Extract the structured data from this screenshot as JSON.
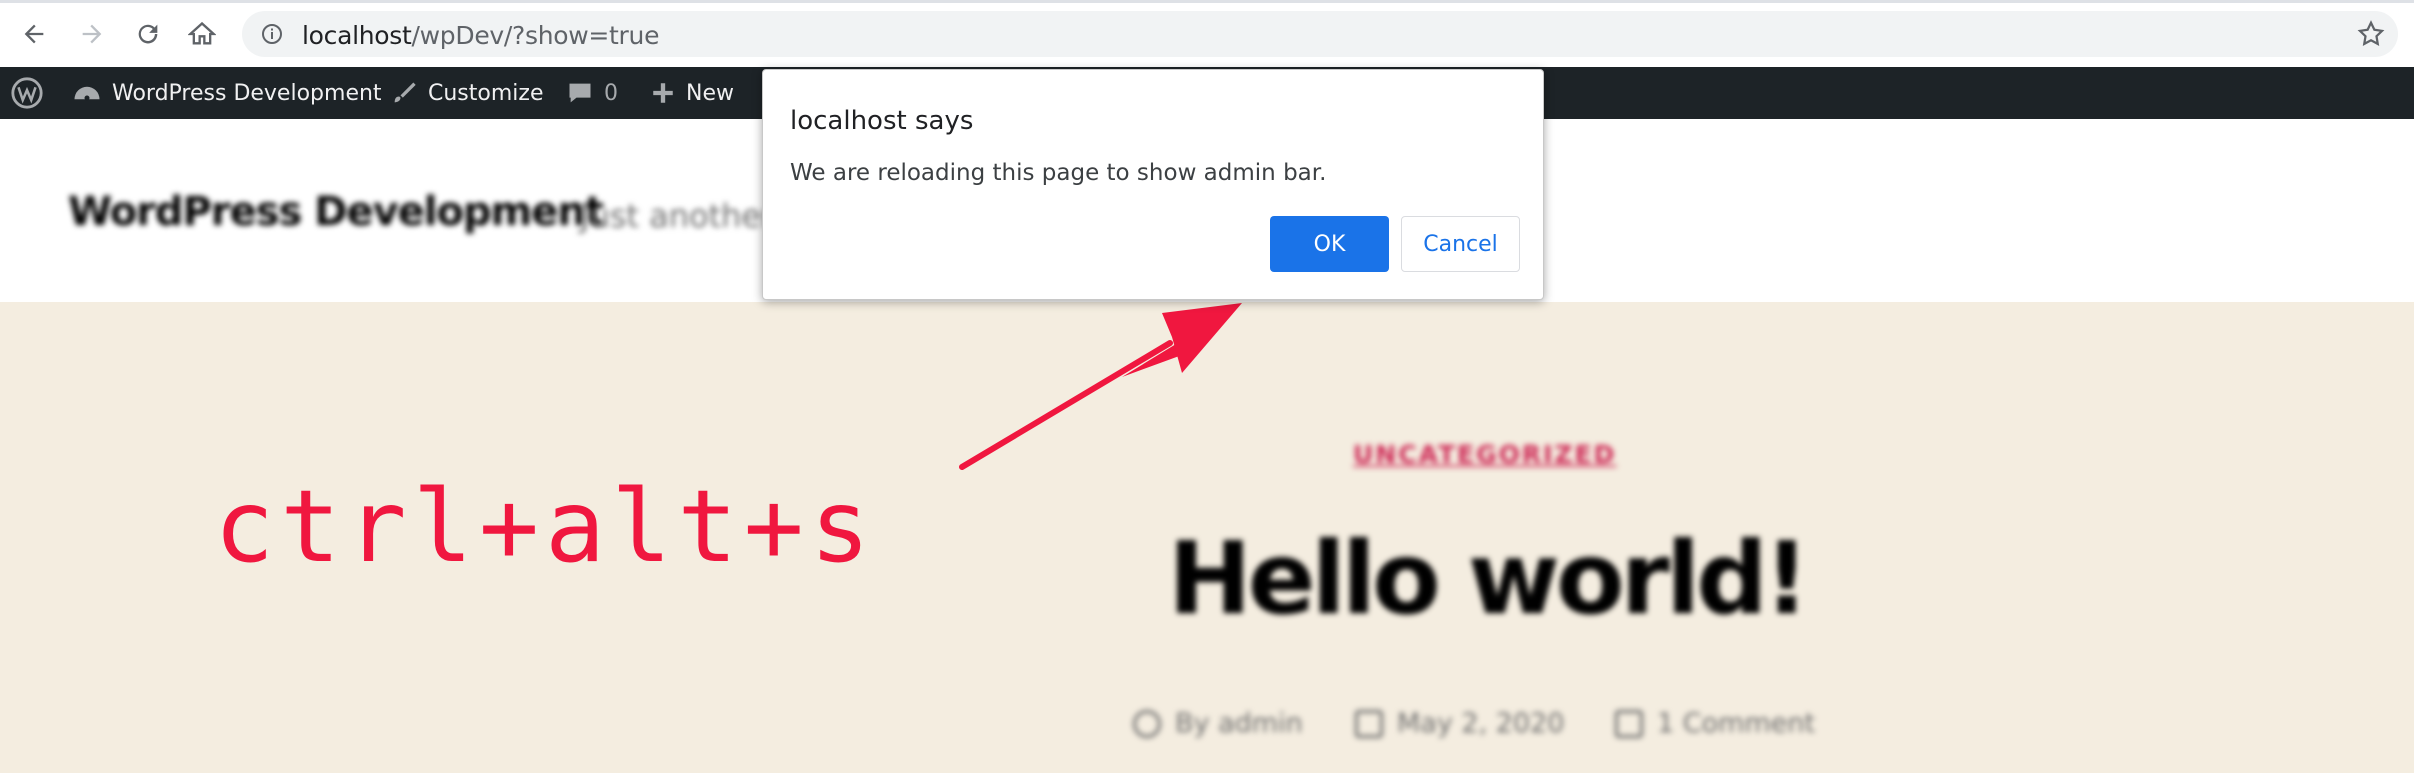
{
  "browser": {
    "url_host": "localhost",
    "url_path": "/wpDev/?show=true",
    "icons": [
      "back-icon",
      "forward-icon",
      "reload-icon",
      "home-icon",
      "info-icon",
      "bookmark-star-icon"
    ]
  },
  "adminbar": {
    "site_name": "WordPress Development",
    "customize": "Customize",
    "comments_count": "0",
    "new_label": "New"
  },
  "page": {
    "site_title": "WordPress Development",
    "site_description": "Just another",
    "category": "UNCATEGORIZED",
    "post_title": "Hello world!",
    "meta_author": "By admin",
    "meta_date": "May 2, 2020",
    "meta_comments": "1 Comment"
  },
  "dialog": {
    "title": "localhost says",
    "message": "We are reloading this page to show admin bar.",
    "ok_label": "OK",
    "cancel_label": "Cancel"
  },
  "annotation": {
    "text": "ctrl+alt+s",
    "color": "#f0173f"
  },
  "colors": {
    "adminbar": "#1d2327",
    "page_bg": "#f4ede0",
    "accent": "#1a73e8"
  }
}
